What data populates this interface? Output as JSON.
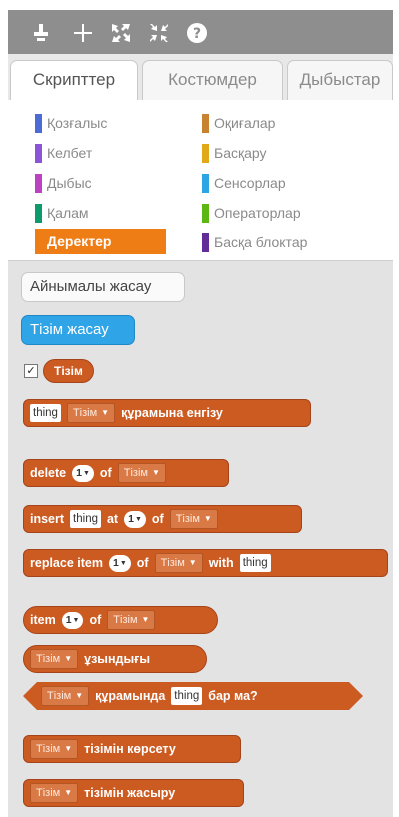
{
  "toolbar": {
    "icons": [
      "duplicate-stamp-icon",
      "add-crosshair-icon",
      "grow-icon",
      "shrink-icon",
      "help-icon"
    ]
  },
  "tabs": [
    {
      "label": "Скрипттер",
      "active": true
    },
    {
      "label": "Костюмдер",
      "active": false
    },
    {
      "label": "Дыбыстар",
      "active": false
    }
  ],
  "categories": [
    {
      "label": "Қозғалыс",
      "color": "#4a6cd4"
    },
    {
      "label": "Оқиғалар",
      "color": "#c88330"
    },
    {
      "label": "Келбет",
      "color": "#8a55d7"
    },
    {
      "label": "Басқару",
      "color": "#e1a91a"
    },
    {
      "label": "Дыбыс",
      "color": "#bb42c3"
    },
    {
      "label": "Сенсорлар",
      "color": "#2ca5e2"
    },
    {
      "label": "Қалам",
      "color": "#0e9a6c"
    },
    {
      "label": "Операторлар",
      "color": "#5cb712"
    },
    {
      "label": "Деректер",
      "color": "#ee7d16",
      "selected": true
    },
    {
      "label": "Басқа блоктар",
      "color": "#632d99"
    }
  ],
  "buttons": {
    "make_variable": "Айнымалы жасау",
    "make_list": "Тізім жасау"
  },
  "list_reporter": {
    "name": "Тізім",
    "checked": "✓"
  },
  "blocks": {
    "add": {
      "input": "thing",
      "list": "Тізім",
      "text": "құрамына енгізу"
    },
    "delete": {
      "kw1": "delete",
      "num": "1",
      "kw2": "of",
      "list": "Тізім"
    },
    "insert": {
      "kw1": "insert",
      "input": "thing",
      "kw2": "at",
      "num": "1",
      "kw3": "of",
      "list": "Тізім"
    },
    "replace": {
      "kw1": "replace item",
      "num": "1",
      "kw2": "of",
      "list": "Тізім",
      "kw3": "with",
      "input": "thing"
    },
    "item": {
      "kw1": "item",
      "num": "1",
      "kw2": "of",
      "list": "Тізім"
    },
    "length": {
      "list": "Тізім",
      "text": "ұзындығы"
    },
    "contains": {
      "list": "Тізім",
      "text1": "құрамында",
      "input": "thing",
      "text2": "бар ма?"
    },
    "show": {
      "list": "Тізім",
      "text": "тізімін көрсету"
    },
    "hide": {
      "list": "Тізім",
      "text": "тізімін жасыру"
    }
  },
  "dropdown_arrow": "▼",
  "colors": {
    "data_block": "#cc5b22",
    "make_list_button": "#2fa4e7",
    "selected_category": "#ee7d16"
  }
}
